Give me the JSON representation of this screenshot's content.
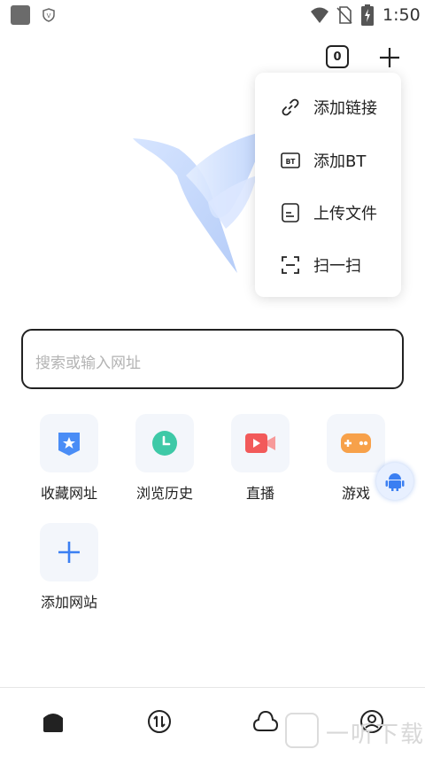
{
  "status_bar": {
    "time": "1:50",
    "icons": [
      "app-icon",
      "shield-icon",
      "wifi-icon",
      "no-sim-icon",
      "battery-charging-icon"
    ]
  },
  "header": {
    "tab_count": "0",
    "add_icon": "plus-icon"
  },
  "menu": {
    "items": [
      {
        "label": "添加链接",
        "icon": "link-icon"
      },
      {
        "label": "添加BT",
        "icon": "bt-icon"
      },
      {
        "label": "上传文件",
        "icon": "file-icon"
      },
      {
        "label": "扫一扫",
        "icon": "scan-icon"
      }
    ]
  },
  "search": {
    "placeholder": "搜索或输入网址"
  },
  "shortcuts": [
    {
      "label": "收藏网址",
      "icon": "bookmark-star-icon",
      "color": "#4a8df6"
    },
    {
      "label": "浏览历史",
      "icon": "history-clock-icon",
      "color": "#3ec9a7"
    },
    {
      "label": "直播",
      "icon": "live-video-icon",
      "color": "#f25a5a"
    },
    {
      "label": "游戏",
      "icon": "gamepad-icon",
      "color": "#f7a14a"
    },
    {
      "label": "添加网站",
      "icon": "plus-icon",
      "color": "#3b7ff2"
    }
  ],
  "bottom_nav": {
    "items": [
      "home-icon",
      "transfer-icon",
      "cloud-icon",
      "profile-icon"
    ]
  },
  "watermark": {
    "text": "一听下载"
  },
  "colors": {
    "accent": "#3b7ff2",
    "text": "#222222",
    "placeholder": "#b3b3b3"
  }
}
